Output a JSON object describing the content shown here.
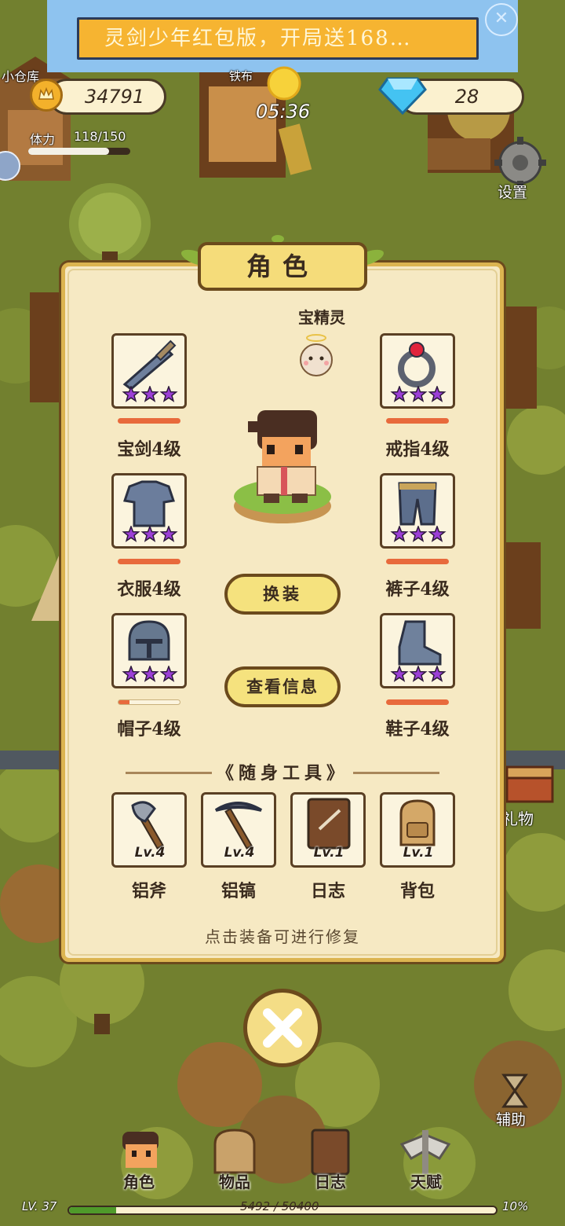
{
  "ad": {
    "text": "灵剑少年红包版，开局送168…",
    "close": "✕"
  },
  "hud": {
    "warehouse_label": "小仓库",
    "coins": "34791",
    "stamina_label": "体力",
    "stamina_value": "118/150",
    "stamina_fraction": 0.79,
    "shop_label": "铁布",
    "time": "05:36",
    "gems": "28",
    "settings_label": "设置",
    "gift_label": "礼物",
    "assist_label": "辅助"
  },
  "panel": {
    "title": "角色",
    "pet_name": "宝精灵",
    "equipment": [
      {
        "name": "宝剑4级",
        "icon": "sword-icon",
        "stars": 3,
        "durability": 1.0
      },
      {
        "name": "戒指4级",
        "icon": "ring-icon",
        "stars": 3,
        "durability": 1.0
      },
      {
        "name": "衣服4级",
        "icon": "armor-icon",
        "stars": 3,
        "durability": 1.0
      },
      {
        "name": "裤子4级",
        "icon": "pants-icon",
        "stars": 3,
        "durability": 1.0
      },
      {
        "name": "帽子4级",
        "icon": "helmet-icon",
        "stars": 3,
        "durability": 0.18
      },
      {
        "name": "鞋子4级",
        "icon": "boots-icon",
        "stars": 3,
        "durability": 1.0
      }
    ],
    "change_button": "换装",
    "info_button": "查看信息",
    "tools_header": "随身工具",
    "tools": [
      {
        "name": "铝斧",
        "level": "Lv.4",
        "icon": "axe-icon"
      },
      {
        "name": "铝镐",
        "level": "Lv.4",
        "icon": "pickaxe-icon"
      },
      {
        "name": "日志",
        "level": "Lv.1",
        "icon": "journal-icon"
      },
      {
        "name": "背包",
        "level": "Lv.1",
        "icon": "backpack-icon"
      }
    ],
    "hint": "点击装备可进行修复"
  },
  "nav": [
    {
      "label": "角色",
      "icon": "character-icon"
    },
    {
      "label": "物品",
      "icon": "backpack-icon"
    },
    {
      "label": "日志",
      "icon": "journal-icon"
    },
    {
      "label": "天赋",
      "icon": "talent-wings-icon"
    }
  ],
  "status": {
    "level": "LV. 37",
    "xp": "5492 / 50400",
    "xp_percent": "10%",
    "xp_fraction": 0.11
  },
  "colors": {
    "panel_bg": "#f6e9c3",
    "panel_border": "#dcb450",
    "star": "#9b3fd6",
    "durability": "#e86a3c",
    "xp": "#4f9a2a"
  }
}
